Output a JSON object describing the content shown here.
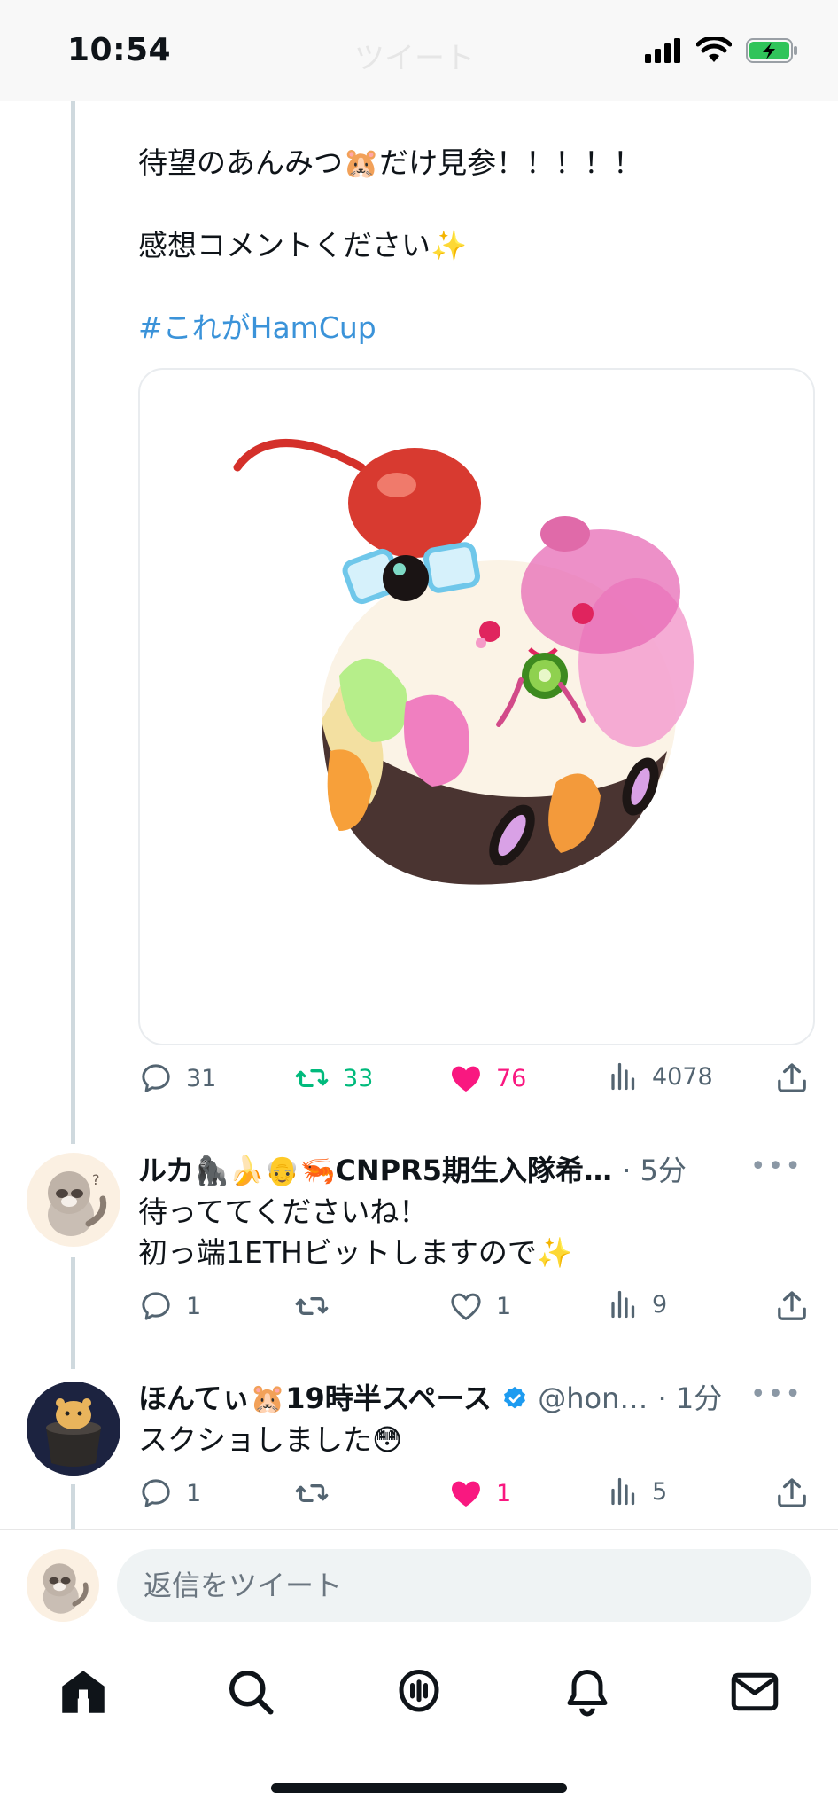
{
  "status_bar": {
    "time": "10:54"
  },
  "header": {
    "title": "ツイート"
  },
  "tweet": {
    "line1": "待望のあんみつ🐹だけ見参！！！！！",
    "line2": "感想コメントください✨",
    "hashtag": "#これがHamCup",
    "media_icon": "hamster-anmitsu-illustration",
    "replies": "31",
    "retweets": "33",
    "likes": "76",
    "views": "4078"
  },
  "replies": [
    {
      "name": "ルカ🦍🍌👴🦐CNPR5期生入隊希…",
      "time": "· 5分",
      "text_line1": "待っててくださいね！",
      "text_line2": "初っ端1ETHビットしますので✨",
      "replies": "1",
      "retweets": "",
      "likes": "1",
      "views": "9",
      "liked": false
    },
    {
      "name": "ほんてぃ🐹19時半スペース",
      "handle": "@hon…",
      "time": "· 1分",
      "text": "スクショしました😳",
      "replies": "1",
      "retweets": "",
      "likes": "1",
      "views": "5",
      "liked": true,
      "verified": true
    }
  ],
  "composer": {
    "placeholder": "返信をツイート"
  },
  "tabbar": {
    "items": [
      "home-icon",
      "search-icon",
      "spaces-icon",
      "notifications-icon",
      "messages-icon"
    ]
  },
  "colors": {
    "accent": "#1d9bf0",
    "like": "#f91880",
    "retweet": "#00ba7c",
    "hashtag": "#3b93d9"
  }
}
